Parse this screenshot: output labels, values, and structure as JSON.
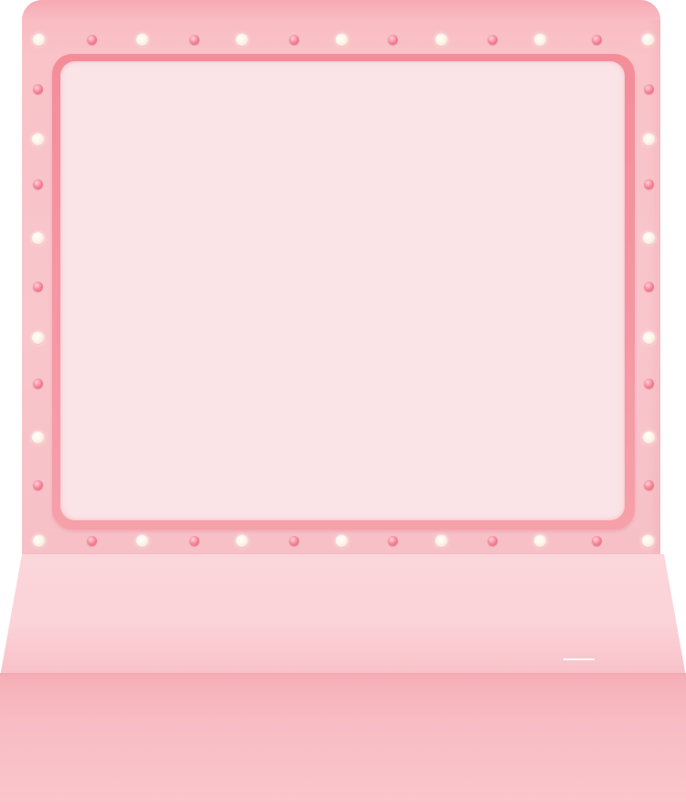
{
  "scene": {
    "description_items": [
      "board",
      "frame",
      "screen",
      "bulbs",
      "counter"
    ],
    "colors": {
      "board": "#f8c6cb",
      "frame": "#f48d99",
      "screen": "#fbe4e7",
      "bulb_white": "#fff6e8",
      "bulb_pink": "#f47f93",
      "counter_top": "#fbd6da",
      "counter_front": "#f6aeb6"
    },
    "bulb_count_per_row": 13,
    "bulb_count_per_side": 9
  }
}
